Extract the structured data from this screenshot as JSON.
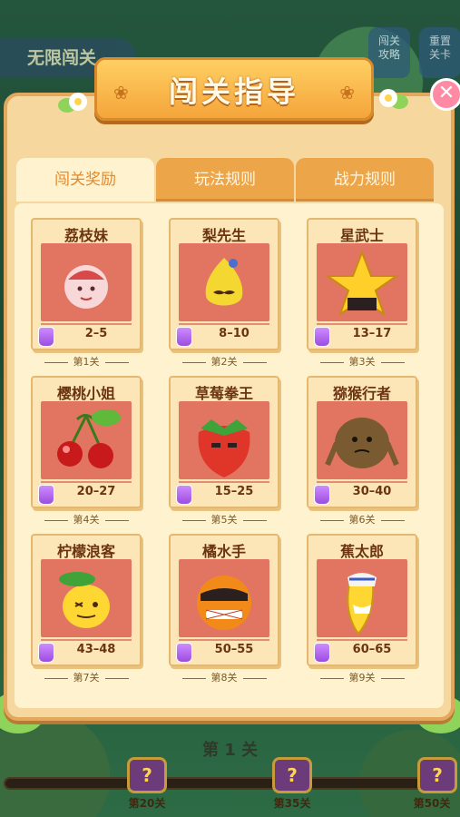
{
  "background": {
    "top_left_pill": "无限闯关",
    "top_buttons": [
      "闯关\n攻略",
      "重置\n关卡"
    ],
    "current_level": "第 1 关",
    "chests": [
      {
        "label": "第20关"
      },
      {
        "label": "第35关"
      },
      {
        "label": "第50关"
      }
    ]
  },
  "dialog": {
    "title": "闯关指导",
    "close_icon": "close-icon",
    "tabs": [
      {
        "label": "闯关奖励",
        "active": true
      },
      {
        "label": "玩法规则",
        "active": false
      },
      {
        "label": "战力规则",
        "active": false
      }
    ],
    "cards": [
      {
        "name": "荔枝妹",
        "range": "2–5",
        "level": "第1关",
        "fruit": "lychee"
      },
      {
        "name": "梨先生",
        "range": "8–10",
        "level": "第2关",
        "fruit": "pear"
      },
      {
        "name": "星武士",
        "range": "13–17",
        "level": "第3关",
        "fruit": "star"
      },
      {
        "name": "樱桃小姐",
        "range": "20–27",
        "level": "第4关",
        "fruit": "cherry"
      },
      {
        "name": "草莓拳王",
        "range": "15–25",
        "level": "第5关",
        "fruit": "strawberry"
      },
      {
        "name": "猕猴行者",
        "range": "30–40",
        "level": "第6关",
        "fruit": "kiwi"
      },
      {
        "name": "柠檬浪客",
        "range": "43–48",
        "level": "第7关",
        "fruit": "lemon"
      },
      {
        "name": "橘水手",
        "range": "50–55",
        "level": "第8关",
        "fruit": "orange"
      },
      {
        "name": "蕉太郎",
        "range": "60–65",
        "level": "第9关",
        "fruit": "banana"
      }
    ]
  },
  "colors": {
    "accent": "#e48a2a",
    "card_art_bg": "#e27561",
    "potion": "#b26af0"
  }
}
